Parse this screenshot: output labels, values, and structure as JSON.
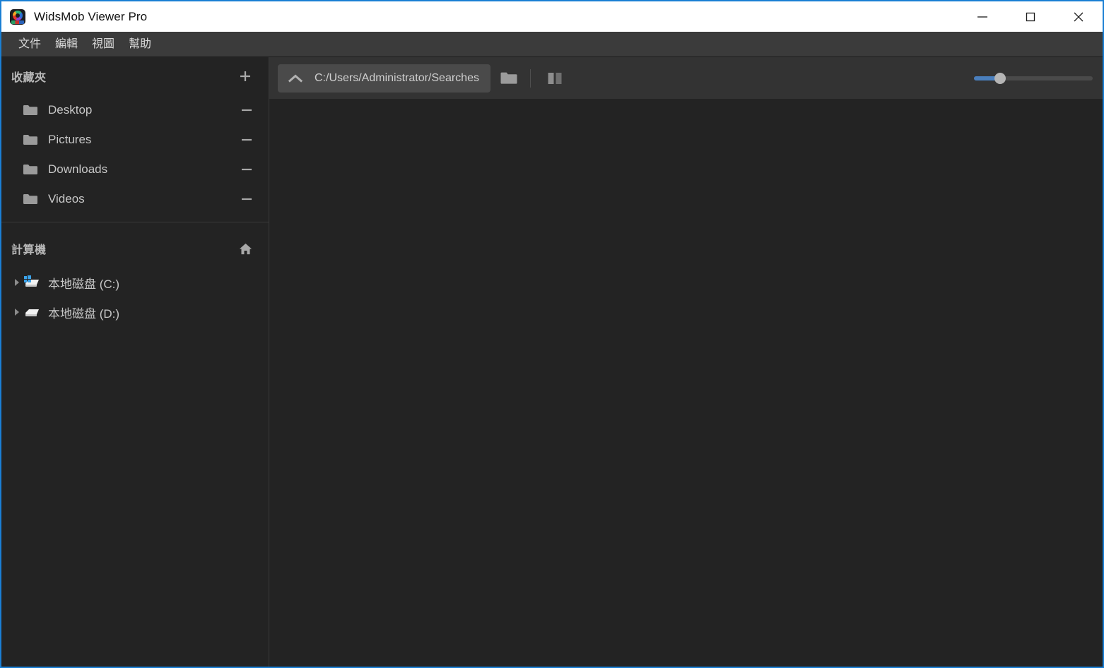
{
  "window": {
    "title": "WidsMob Viewer Pro",
    "app_icon": "widsmob-logo-icon",
    "accent_border_color": "#1a7fd4",
    "controls": {
      "minimize": "minimize-icon",
      "maximize": "maximize-icon",
      "close": "close-icon"
    }
  },
  "menu": {
    "items": [
      {
        "label": "文件"
      },
      {
        "label": "編輯"
      },
      {
        "label": "視圖"
      },
      {
        "label": "幫助"
      }
    ]
  },
  "sidebar": {
    "favorites": {
      "title": "收藏夾",
      "add_icon": "plus-icon",
      "items": [
        {
          "label": "Desktop",
          "icon": "folder-icon",
          "action_icon": "minus-icon"
        },
        {
          "label": "Pictures",
          "icon": "folder-icon",
          "action_icon": "minus-icon"
        },
        {
          "label": "Downloads",
          "icon": "folder-icon",
          "action_icon": "minus-icon"
        },
        {
          "label": "Videos",
          "icon": "folder-icon",
          "action_icon": "minus-icon"
        }
      ]
    },
    "computer": {
      "title": "計算機",
      "home_icon": "home-icon",
      "items": [
        {
          "label": "本地磁盘 (C:)",
          "icon": "hard-drive-windows-icon",
          "arrow_icon": "triangle-right-icon"
        },
        {
          "label": "本地磁盘 (D:)",
          "icon": "hard-drive-icon",
          "arrow_icon": "triangle-right-icon"
        }
      ]
    }
  },
  "toolbar": {
    "up_icon": "chevron-up-icon",
    "path": "C:/Users/Administrator/Searches",
    "path_placeholder": "C:/Users/Administrator/Searches",
    "open_folder_icon": "folder-open-icon",
    "split_view_icon": "split-view-icon",
    "zoom_slider": {
      "name": "thumbnail-size-slider",
      "value_percent": 22,
      "fill_color": "#4a7fbd",
      "handle_color": "#b5b5b5"
    }
  },
  "viewer": {
    "empty": ""
  }
}
